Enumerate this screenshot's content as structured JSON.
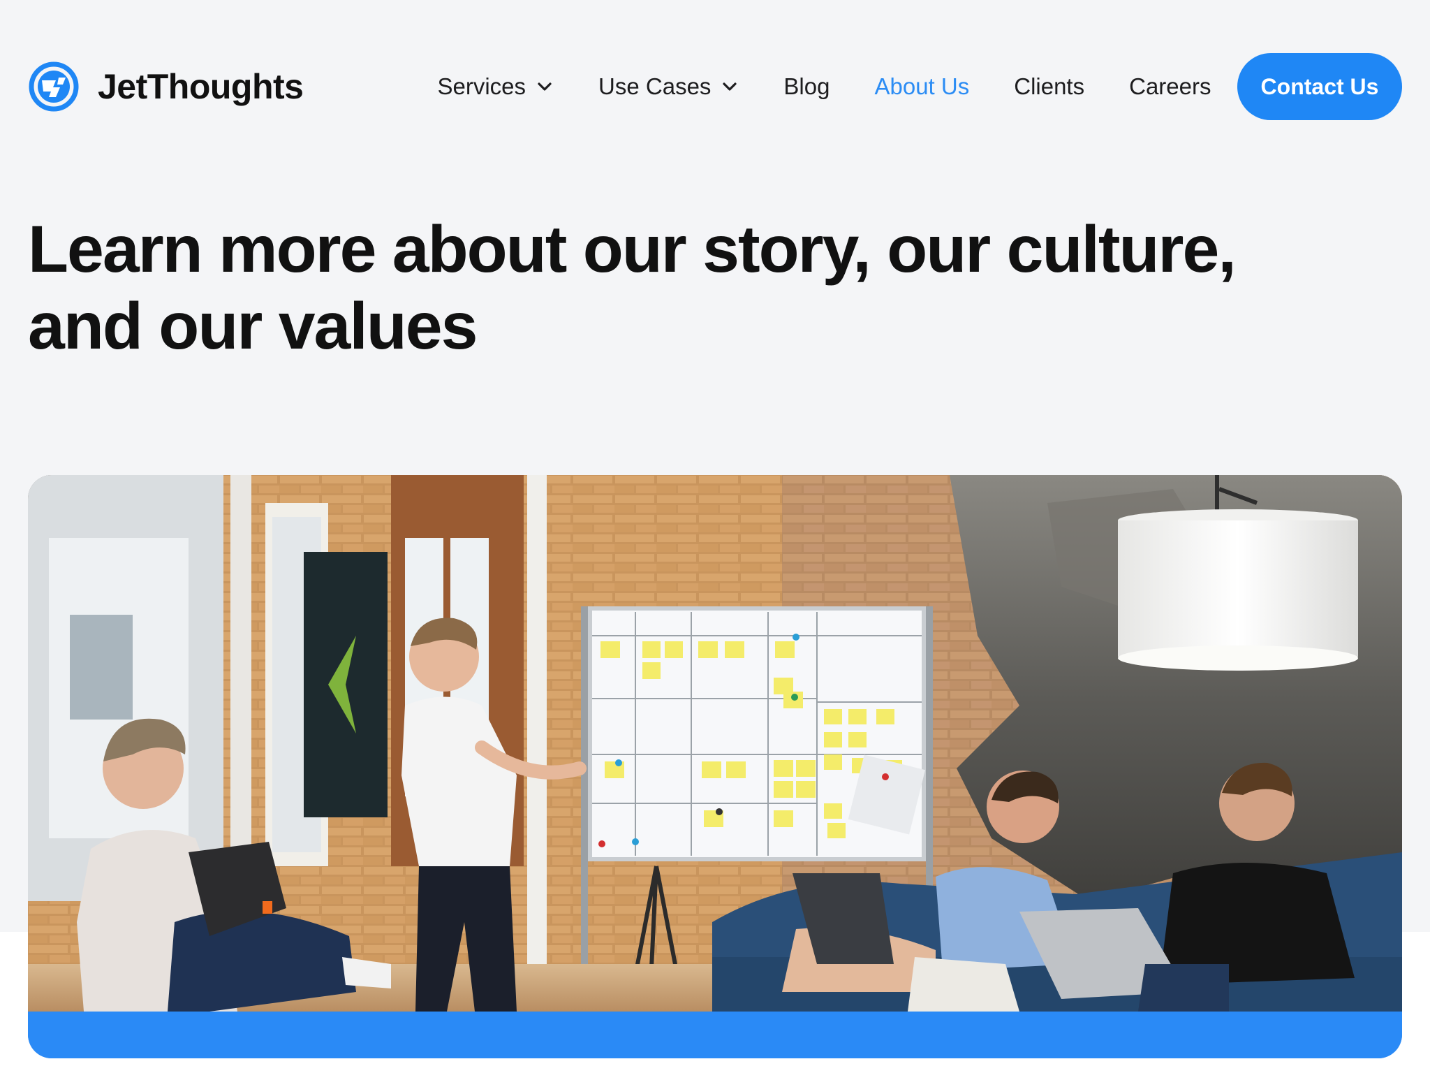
{
  "brand": {
    "name": "JetThoughts",
    "accent": "#1f87f5",
    "logo_icon": "jetthoughts-logo-icon"
  },
  "nav": {
    "items": [
      {
        "label": "Services",
        "has_dropdown": true
      },
      {
        "label": "Use Cases",
        "has_dropdown": true
      },
      {
        "label": "Blog",
        "has_dropdown": false
      },
      {
        "label": "About Us",
        "has_dropdown": false,
        "active": true
      },
      {
        "label": "Clients",
        "has_dropdown": false
      },
      {
        "label": "Careers",
        "has_dropdown": false
      }
    ],
    "active_color": "#2b8cf4"
  },
  "cta": {
    "label": "Contact Us"
  },
  "hero": {
    "title_line1": "Learn more about our story, our culture,",
    "title_line2": "and our values"
  },
  "photo": {
    "alt": "",
    "strip_color": "#2a8af6"
  }
}
